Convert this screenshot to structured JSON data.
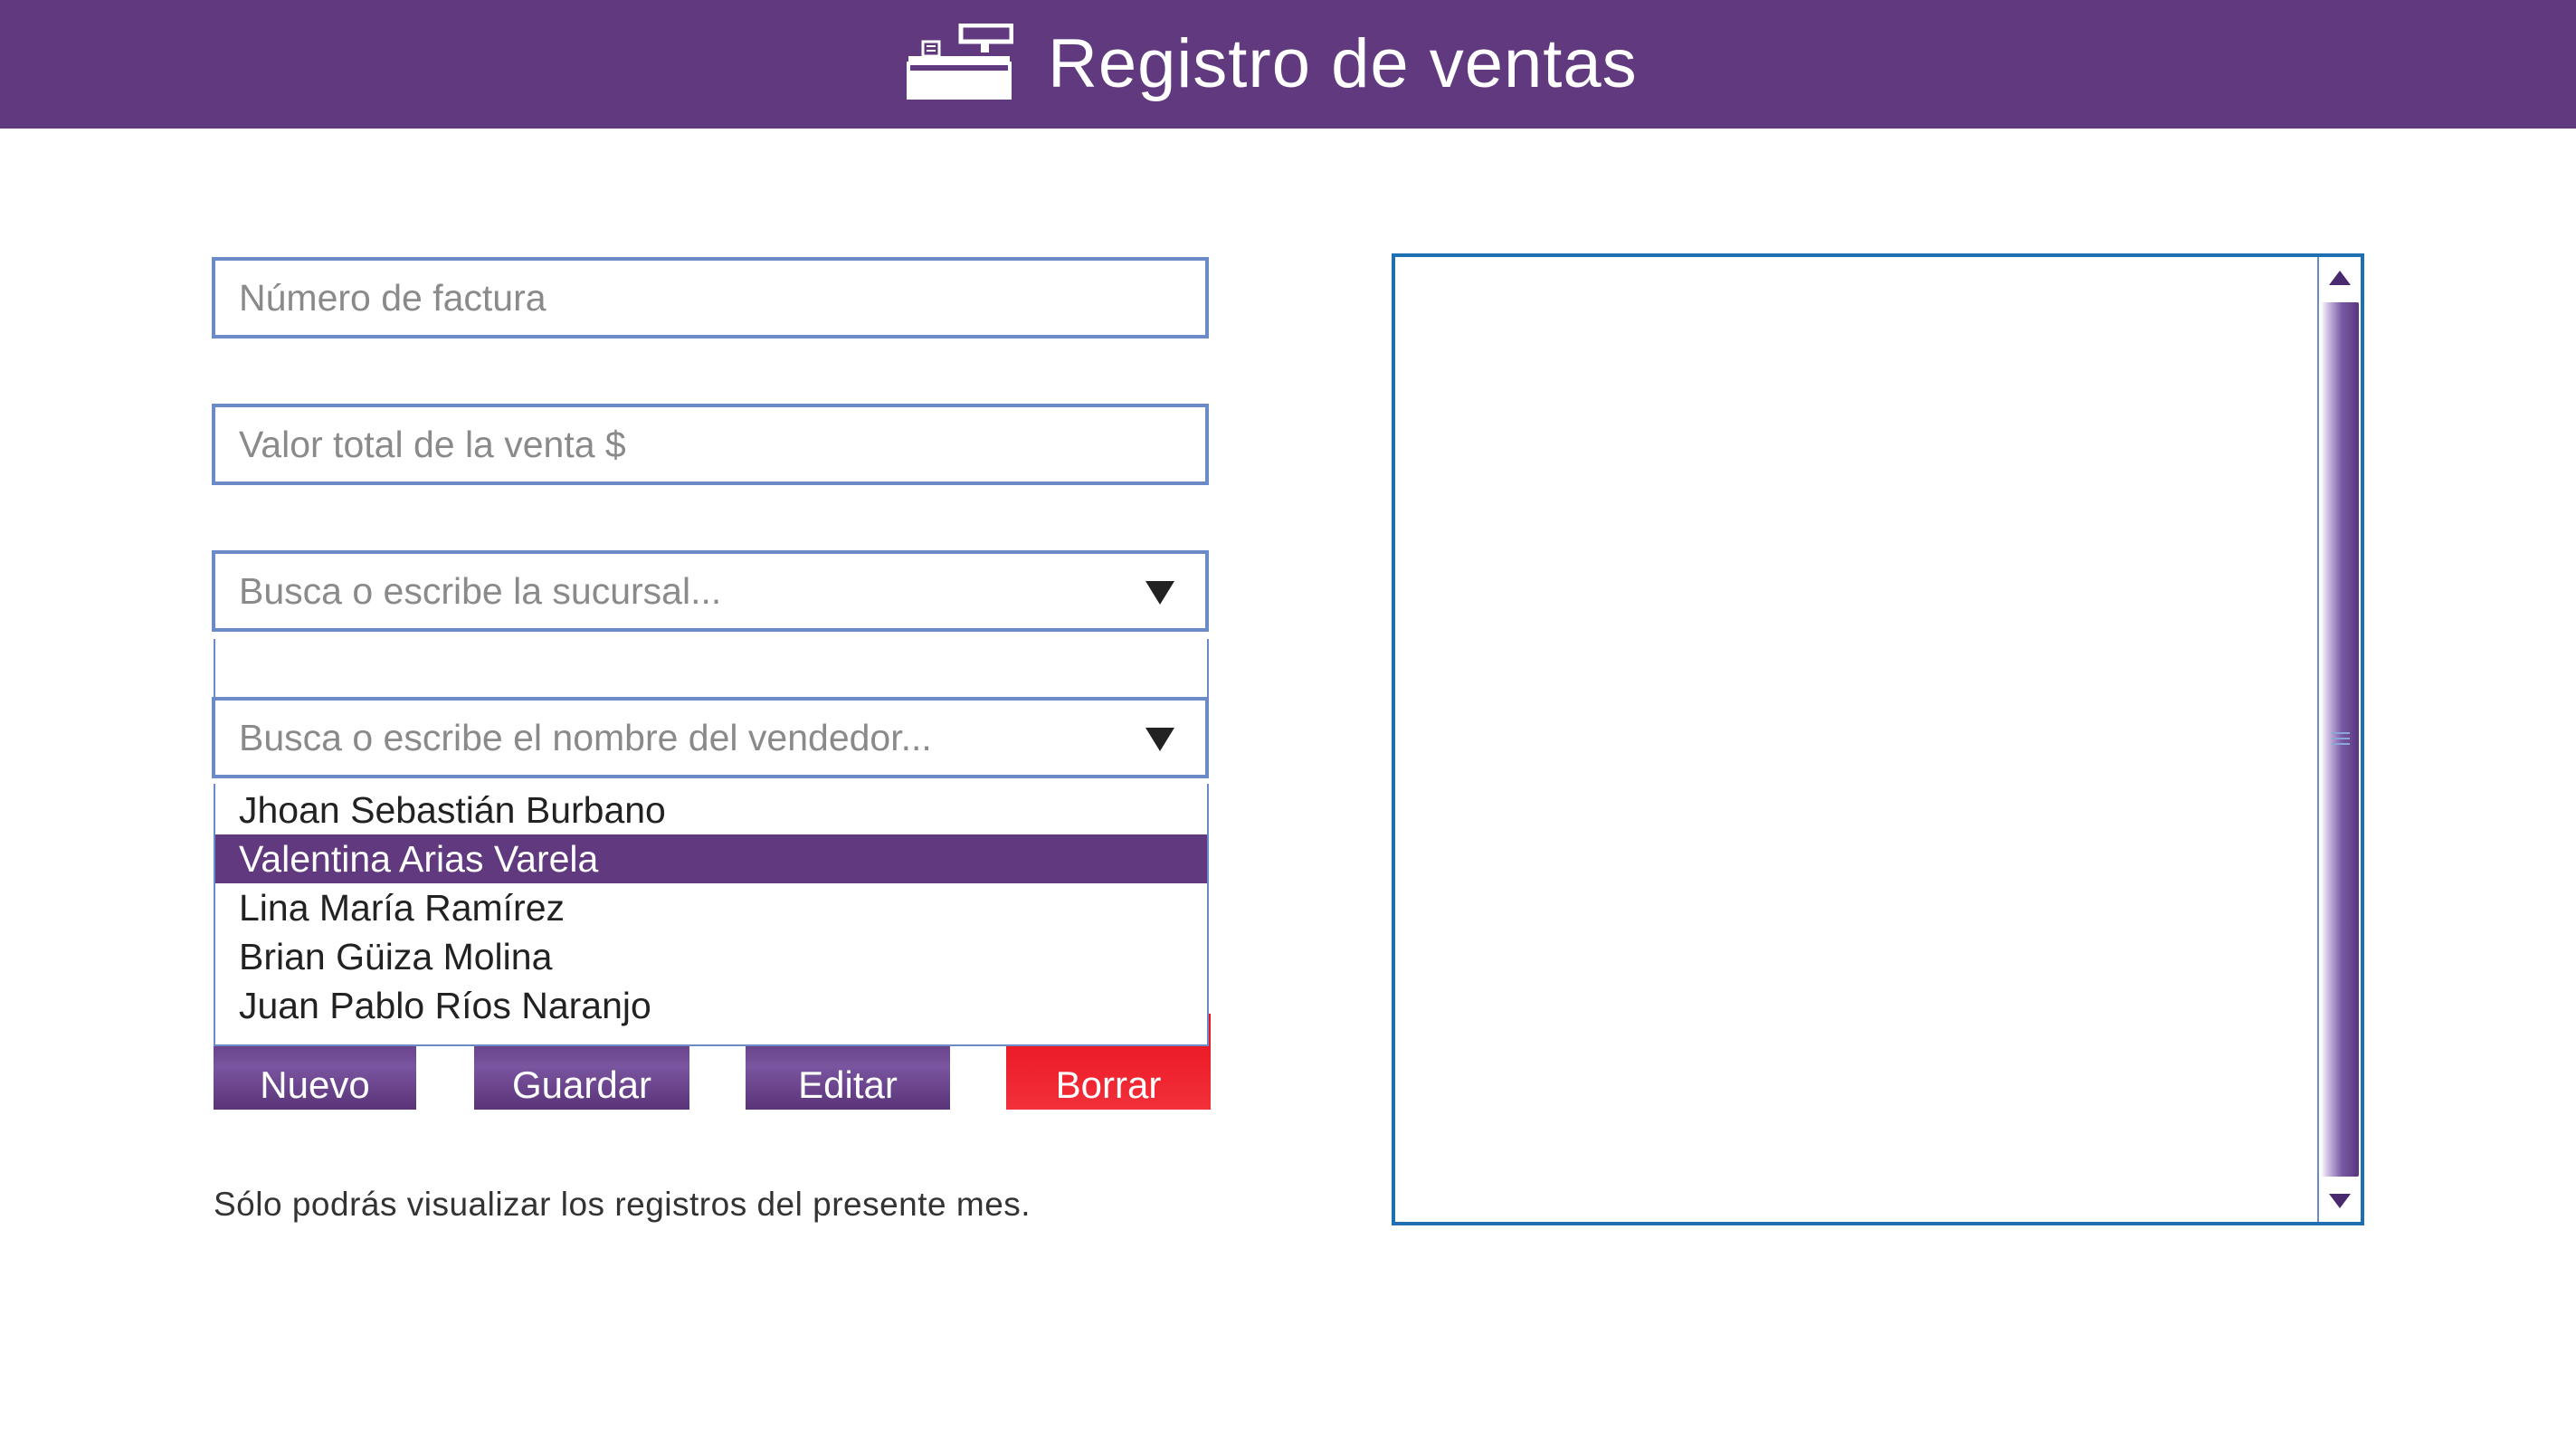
{
  "header": {
    "title": "Registro de ventas",
    "icon": "cash-register-icon"
  },
  "form": {
    "invoice_placeholder": "Número de factura",
    "total_placeholder": "Valor total de la venta $",
    "branch_placeholder": "Busca o escribe la sucursal...",
    "seller_placeholder": "Busca o escribe el nombre del vendedor..."
  },
  "seller_dropdown": {
    "options": [
      "Jhoan Sebastián Burbano",
      "Valentina Arias Varela",
      "Lina María Ramírez",
      "Brian Güiza Molina",
      "Juan Pablo Ríos Naranjo"
    ],
    "highlighted": "Valentina Arias Varela"
  },
  "buttons": {
    "new": "Nuevo",
    "save": "Guardar",
    "edit": "Editar",
    "delete": "Borrar"
  },
  "footnote": "Sólo podrás visualizar los registros del presente mes.",
  "colors": {
    "brand_purple": "#61397f",
    "delete_red": "#ea1220",
    "panel_border": "#1f6fb3",
    "field_border": "#6a8bc6"
  }
}
